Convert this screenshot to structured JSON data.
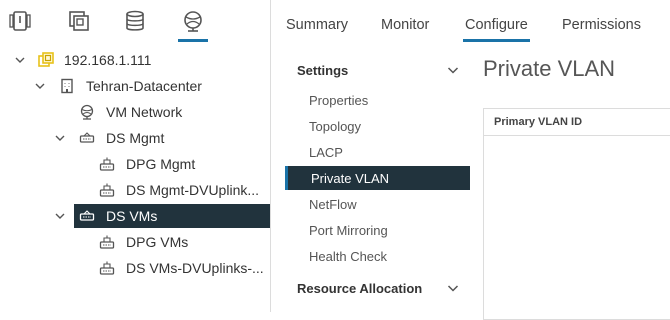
{
  "navigator": {
    "tabs": [
      {
        "icon": "hosts-clusters-icon"
      },
      {
        "icon": "vms-templates-icon"
      },
      {
        "icon": "storage-icon"
      },
      {
        "icon": "networking-icon",
        "active": true
      }
    ],
    "tree": [
      {
        "label": "192.168.1.111",
        "icon": "vcenter-icon"
      },
      {
        "label": "Tehran-Datacenter",
        "icon": "datacenter-icon"
      },
      {
        "label": "VM Network",
        "icon": "network-icon"
      },
      {
        "label": "DS Mgmt",
        "icon": "distributed-switch-icon"
      },
      {
        "label": "DPG Mgmt",
        "icon": "port-group-icon"
      },
      {
        "label": "DS Mgmt-DVUplink...",
        "icon": "port-group-icon"
      },
      {
        "label": "DS VMs",
        "icon": "distributed-switch-icon",
        "selected": true
      },
      {
        "label": "DPG VMs",
        "icon": "port-group-icon"
      },
      {
        "label": "DS VMs-DVUplinks-...",
        "icon": "port-group-icon"
      }
    ]
  },
  "tabs": {
    "summary": "Summary",
    "monitor": "Monitor",
    "configure": "Configure",
    "permissions": "Permissions",
    "active": "Configure"
  },
  "side_menu": {
    "settings_header": "Settings",
    "items": [
      "Properties",
      "Topology",
      "LACP",
      "Private VLAN",
      "NetFlow",
      "Port Mirroring",
      "Health Check"
    ],
    "active_item": "Private VLAN",
    "resource_header": "Resource Allocation"
  },
  "content": {
    "title": "Private VLAN",
    "column_header": "Primary VLAN ID"
  },
  "colors": {
    "accent": "#1a73a8",
    "selected_bg": "#21333d",
    "vcenter_yellow": "#e8c21a"
  }
}
